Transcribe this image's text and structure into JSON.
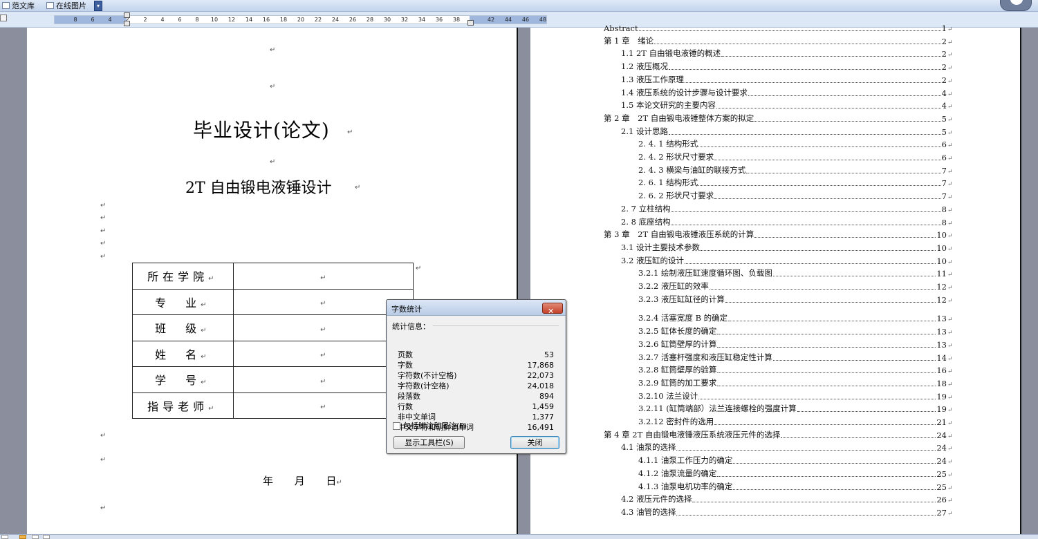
{
  "toolbar": {
    "items": [
      {
        "label": "范文库"
      },
      {
        "label": "在线图片"
      }
    ],
    "dropdown_glyph": "▾"
  },
  "ruler": {
    "ticks": [
      "8",
      "6",
      "4",
      "2",
      "2",
      "4",
      "6",
      "8",
      "10",
      "12",
      "14",
      "16",
      "18",
      "20",
      "22",
      "24",
      "26",
      "28",
      "30",
      "32",
      "34",
      "36",
      "38",
      "42",
      "44",
      "46",
      "48"
    ]
  },
  "cover": {
    "title": "毕业设计(论文)",
    "subtitle": "2T 自由锻电液锤设计",
    "table": [
      {
        "label": "所在学院",
        "value": ""
      },
      {
        "label": "专　业",
        "value": ""
      },
      {
        "label": "班　级",
        "value": ""
      },
      {
        "label": "姓　名",
        "value": ""
      },
      {
        "label": "学　号",
        "value": ""
      },
      {
        "label": "指导老师",
        "value": ""
      }
    ],
    "date": "年 月 日"
  },
  "toc": [
    {
      "text": "Abstract",
      "page": "1"
    },
    {
      "text": "第 1 章　绪论",
      "page": "2"
    },
    {
      "text": "1.1 2T 自由锻电液锤的概述",
      "page": "2"
    },
    {
      "text": "1.2 液压概况",
      "page": "2"
    },
    {
      "text": "1.3 液压工作原理",
      "page": "2"
    },
    {
      "text": "1.4  液压系统的设计步骤与设计要求",
      "page": "4"
    },
    {
      "text": "1.5 本论文研究的主要内容",
      "page": "4"
    },
    {
      "text": "第 2 章　2T 自由锻电液锤整体方案的拟定",
      "page": "5"
    },
    {
      "text": "2.1  设计思路",
      "page": "5"
    },
    {
      "text": "2. 4. 1 结构形式",
      "page": "6"
    },
    {
      "text": "2. 4. 2 形状尺寸要求",
      "page": "6"
    },
    {
      "text": "2. 4. 3 横梁与油缸的联接方式",
      "page": "7"
    },
    {
      "text": "2. 6. 1 结构形式",
      "page": "7"
    },
    {
      "text": "2. 6. 2 形状尺寸要求",
      "page": "7"
    },
    {
      "text": "2. 7 立柱结构",
      "page": "8"
    },
    {
      "text": "2. 8  底座结构",
      "page": "8"
    },
    {
      "text": "第 3 章　2T 自由锻电液锤液压系统的计算",
      "page": "10"
    },
    {
      "text": "3.1  设计主要技术参数",
      "page": "10"
    },
    {
      "text": "3.2  液压缸的设计",
      "page": "10"
    },
    {
      "text": "3.2.1 绘制液压缸速度循环图、负载图",
      "page": "11"
    },
    {
      "text": "3.2.2  液压缸的效率",
      "page": "12"
    },
    {
      "text": "3.2.3  液压缸缸径的计算",
      "page": "12"
    },
    {
      "text": "3.2.4 活塞宽度 B 的确定",
      "page": "13"
    },
    {
      "text": "3.2.5  缸体长度的确定",
      "page": "13"
    },
    {
      "text": "3.2.6 缸筒壁厚的计算",
      "page": "13"
    },
    {
      "text": "3.2.7  活塞杆强度和液压缸稳定性计算",
      "page": "14"
    },
    {
      "text": "3.2.8 缸筒壁厚的验算",
      "page": "16"
    },
    {
      "text": "3.2.9  缸筒的加工要求",
      "page": "18"
    },
    {
      "text": "3.2.10 法兰设计",
      "page": "19"
    },
    {
      "text": "3.2.11 (缸筒端部）法兰连接螺栓的强度计算",
      "page": "19"
    },
    {
      "text": "3.2.12 密封件的选用",
      "page": "21"
    },
    {
      "text": "第 4 章  2T 自由锻电液锤液压系统液压元件的选择",
      "page": "24"
    },
    {
      "text": "4.1 油泵的选择",
      "page": "24"
    },
    {
      "text": "4.1.1  油泵工作压力的确定",
      "page": "24"
    },
    {
      "text": "4.1.2  油泵流量的确定",
      "page": "25"
    },
    {
      "text": "4.1.3  油泵电机功率的确定",
      "page": "25"
    },
    {
      "text": "4.2  液压元件的选择",
      "page": "26"
    },
    {
      "text": "4.3  油管的选择",
      "page": "27"
    }
  ],
  "dialog": {
    "title": "字数统计",
    "close_glyph": "✕",
    "section": "统计信息：",
    "stats": [
      {
        "key": "页数",
        "value": "53"
      },
      {
        "key": "字数",
        "value": "17,868"
      },
      {
        "key": "字符数(不计空格)",
        "value": "22,073"
      },
      {
        "key": "字符数(计空格)",
        "value": "24,018"
      },
      {
        "key": "段落数",
        "value": "894"
      },
      {
        "key": "行数",
        "value": "1,459"
      },
      {
        "key": "非中文单词",
        "value": "1,377"
      },
      {
        "key": "中文字符和朝鲜语单词",
        "value": "16,491"
      }
    ],
    "checkbox_label": "包括脚注和尾注(F)",
    "checkbox_checked": false,
    "toolbar_button": "显示工具栏(S)",
    "close_button": "关闭"
  },
  "paragraph_mark": "↵"
}
